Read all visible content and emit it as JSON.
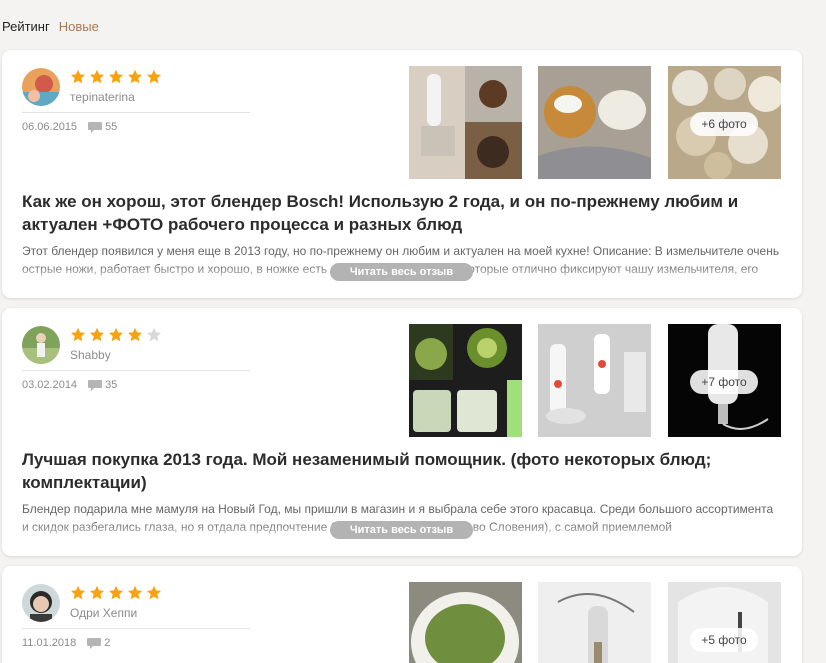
{
  "tabs": {
    "rating": "Рейтинг",
    "new": "Новые"
  },
  "colors": {
    "star_filled": "#f7a310",
    "star_empty": "#d9d9d9",
    "accent": "#a57a55"
  },
  "reviews": [
    {
      "author": "терinaterina",
      "rating": 5,
      "date": "06.06.2015",
      "comments": "55",
      "more_photos": "+6 фото",
      "title": "Как же он хорош, этот блендер Bosch! Использую 2 года, и он по-прежнему любим и актуален +ФОТО рабочего процесса и разных блюд",
      "excerpt": "Этот блендер появился у меня еще в 2013 году, но по-прежнему он любим и актуален на моей кухне! Описание: В измельчителе очень острые ножи, работает быстро и хорошо, в ножке есть специальные выступы, которые отлично фиксируют чашу измельчителя, его",
      "read_more": "Читать весь отзыв"
    },
    {
      "author": "Shabby",
      "rating": 4,
      "date": "03.02.2014",
      "comments": "35",
      "more_photos": "+7 фото",
      "title": "Лучшая покупка 2013 года. Мой незаменимый помощник. (фото некоторых блюд; комплектации)",
      "excerpt": "Блендер подарила мне мамуля на Новый Год, мы пришли в магазин и я выбрала себе этого красавца. Среди большого ассортимента и скидок разбегались глаза, но я отдала предпочтение блендеру этой марки (пр-во Словения), с самой приемлемой",
      "read_more": "Читать весь отзыв"
    },
    {
      "author": "Одри Хеппи",
      "rating": 5,
      "date": "11.01.2018",
      "comments": "2",
      "more_photos": "+5 фото",
      "title": "",
      "excerpt": "",
      "read_more": ""
    }
  ]
}
